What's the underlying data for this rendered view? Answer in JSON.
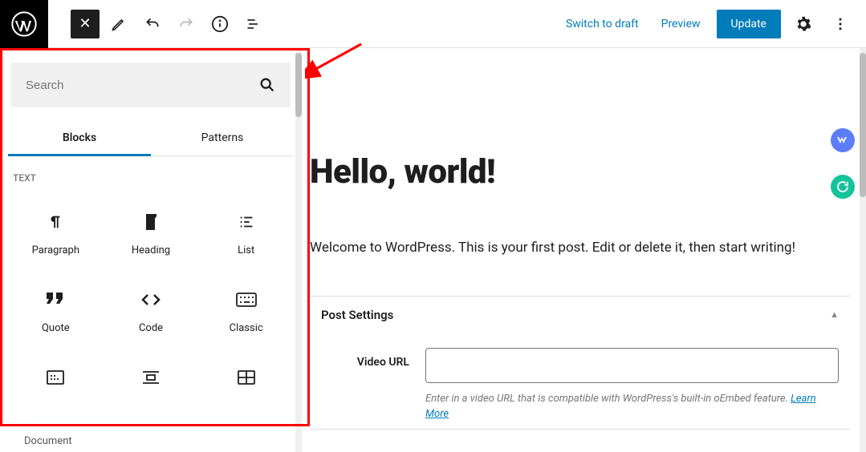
{
  "toolbar": {
    "switch_draft": "Switch to draft",
    "preview": "Preview",
    "update": "Update"
  },
  "inserter": {
    "search_placeholder": "Search",
    "tabs": {
      "blocks": "Blocks",
      "patterns": "Patterns"
    },
    "text_section": "TEXT",
    "blocks": [
      {
        "label": "Paragraph",
        "icon": "paragraph"
      },
      {
        "label": "Heading",
        "icon": "heading"
      },
      {
        "label": "List",
        "icon": "list"
      },
      {
        "label": "Quote",
        "icon": "quote"
      },
      {
        "label": "Code",
        "icon": "code"
      },
      {
        "label": "Classic",
        "icon": "classic"
      },
      {
        "label": "",
        "icon": "preformatted"
      },
      {
        "label": "",
        "icon": "pullquote"
      },
      {
        "label": "",
        "icon": "table"
      }
    ]
  },
  "post": {
    "title": "Hello, world!",
    "body": "Welcome to WordPress. This is your first post. Edit or delete it, then start writing!"
  },
  "settings": {
    "title": "Post Settings",
    "video_url_label": "Video URL",
    "video_url_value": "",
    "help_text_1": "Enter in a video URL that is compatible with WordPress's built-in oEmbed feature. ",
    "learn_more": "Learn More"
  },
  "footer": {
    "path": "Document"
  }
}
